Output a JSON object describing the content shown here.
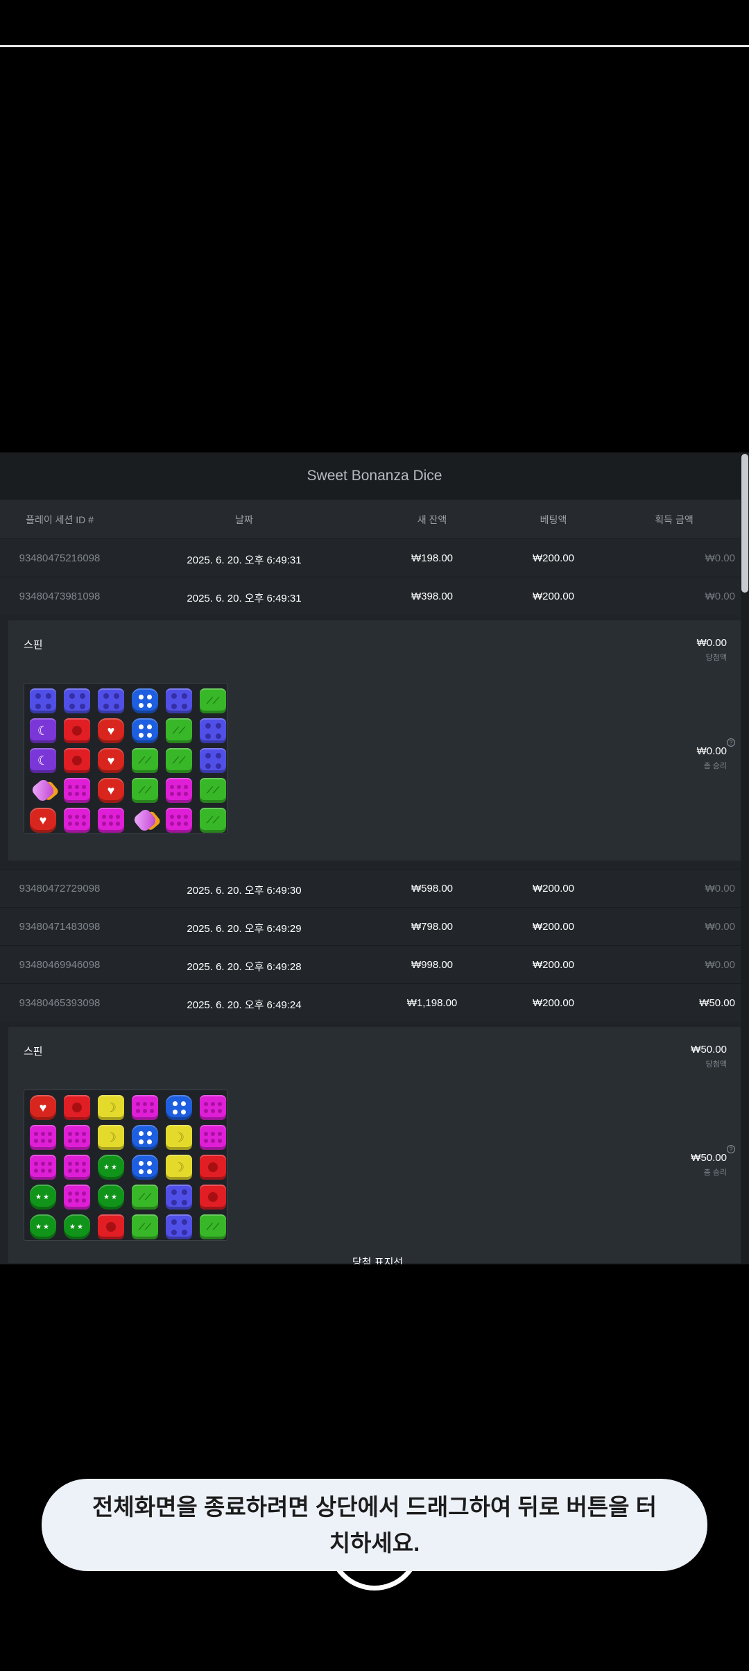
{
  "title": "Sweet Bonanza Dice",
  "columns": [
    "플레이 세션 ID #",
    "날짜",
    "새 잔액",
    "베팅액",
    "획득 금액"
  ],
  "rows_before": [
    {
      "id": "93480475216098",
      "date": "2025. 6. 20. 오후 6:49:31",
      "balance": "₩198.00",
      "bet": "₩200.00",
      "win": "₩0.00"
    },
    {
      "id": "93480473981098",
      "date": "2025. 6. 20. 오후 6:49:31",
      "balance": "₩398.00",
      "bet": "₩200.00",
      "win": "₩0.00"
    }
  ],
  "detail1": {
    "spin": "스핀",
    "amount": "₩0.00",
    "amount_label": "당첨액",
    "total": "₩0.00",
    "total_label": "총 승리",
    "help": "?"
  },
  "rows_middle": [
    {
      "id": "93480472729098",
      "date": "2025. 6. 20. 오후 6:49:30",
      "balance": "₩598.00",
      "bet": "₩200.00",
      "win": "₩0.00"
    },
    {
      "id": "93480471483098",
      "date": "2025. 6. 20. 오후 6:49:29",
      "balance": "₩798.00",
      "bet": "₩200.00",
      "win": "₩0.00"
    },
    {
      "id": "93480469946098",
      "date": "2025. 6. 20. 오후 6:49:28",
      "balance": "₩998.00",
      "bet": "₩200.00",
      "win": "₩0.00"
    },
    {
      "id": "93480465393098",
      "date": "2025. 6. 20. 오후 6:49:24",
      "balance": "₩1,198.00",
      "bet": "₩200.00",
      "win": "₩50.00"
    }
  ],
  "detail2": {
    "spin": "스핀",
    "amount": "₩50.00",
    "amount_label": "당첨액",
    "total": "₩50.00",
    "total_label": "총 승리",
    "help": "?",
    "tip": "당첨 표지선"
  },
  "board1": [
    [
      "blue",
      "blue",
      "blue",
      "dblue",
      "blue",
      "green"
    ],
    [
      "purple",
      "red",
      "redheart",
      "dblue",
      "green",
      "blue"
    ],
    [
      "purple",
      "red",
      "redheart",
      "green",
      "green",
      "blue"
    ],
    [
      "bomb",
      "magenta",
      "redheart",
      "green",
      "magenta",
      "green"
    ],
    [
      "redheart",
      "magenta",
      "magenta",
      "bomb",
      "magenta",
      "green"
    ]
  ],
  "board2": [
    [
      "redheart",
      "red",
      "yellow",
      "magenta",
      "dblue",
      "magenta"
    ],
    [
      "magenta",
      "magenta",
      "yellow",
      "dblue",
      "yellow",
      "magenta"
    ],
    [
      "magenta",
      "magenta",
      "dgreen",
      "dblue",
      "yellow",
      "red"
    ],
    [
      "dgreen",
      "magenta",
      "dgreen",
      "green",
      "blue",
      "red"
    ],
    [
      "dgreen",
      "dgreen",
      "red",
      "green",
      "blue",
      "green"
    ]
  ],
  "toast": "전체화면을 종료하려면 상단에서 드래그하여 뒤로 버튼을 터치하세요."
}
